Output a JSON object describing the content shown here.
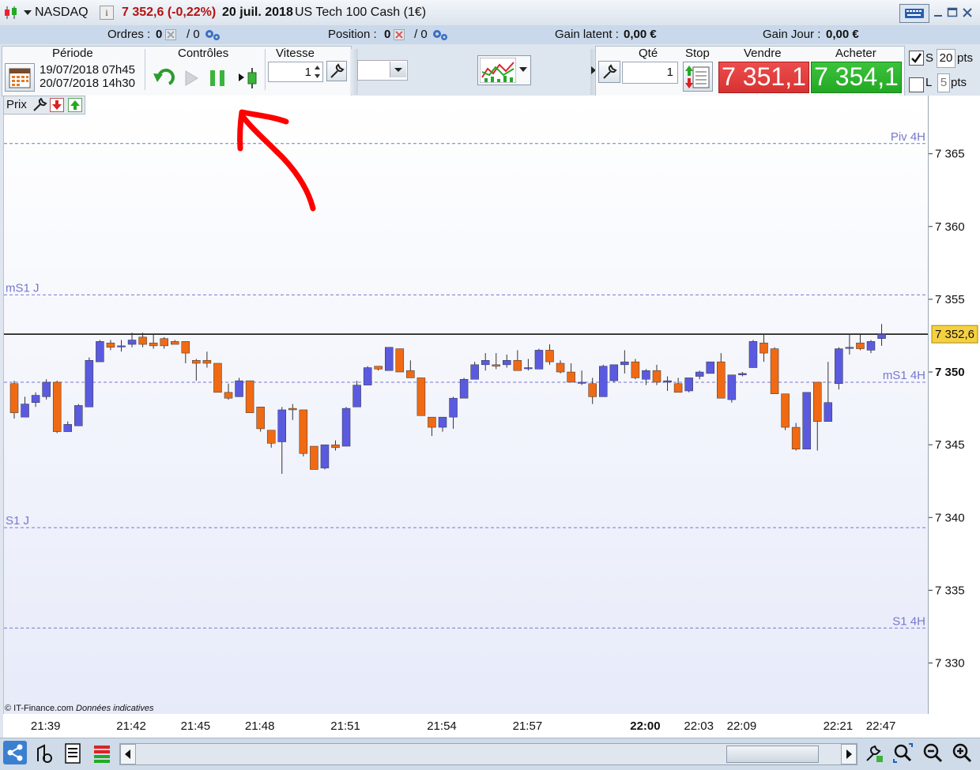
{
  "titlebar": {
    "instrument": "NASDAQ",
    "info_glyph": "i",
    "quote": "7 352,6 (-0,22%)",
    "date": "20 juil. 2018",
    "product": "US Tech 100 Cash (1€)"
  },
  "stats": {
    "orders_label": "Ordres :",
    "orders_value": "0",
    "orders_sep": "/ 0",
    "position_label": "Position :",
    "position_value": "0",
    "position_sep": "/ 0",
    "latent_label": "Gain latent :",
    "latent_value": "0,00 €",
    "day_label": "Gain Jour :",
    "day_value": "0,00 €"
  },
  "controls": {
    "period_label": "Période",
    "period_start": "19/07/2018 07h45",
    "period_end": "20/07/2018 14h30",
    "controls_label": "Contrôles",
    "speed_label": "Vitesse",
    "speed_value": "1",
    "qty_label": "Qté",
    "qty_value": "1",
    "stop_label": "Stop",
    "sell_label": "Vendre",
    "sell_price": "7 351,1",
    "buy_label": "Acheter",
    "buy_price": "7 354,1",
    "s_label": "S",
    "s_value": "20",
    "s_unit": "pts",
    "l_label": "L",
    "l_value": "5",
    "l_unit": "pts"
  },
  "chart_header": {
    "label": "Prix"
  },
  "chart_data": {
    "type": "candlestick",
    "ylim": [
      7326.5,
      7369
    ],
    "yticks": [
      7365,
      7360,
      7355,
      7350,
      7345,
      7340,
      7335,
      7330
    ],
    "ytick_labels": [
      "7 365",
      "7 360",
      "7 355",
      "7 350",
      "7 345",
      "7 340",
      "7 335",
      "7 330"
    ],
    "current_price": 7352.6,
    "current_price_label": "7 352,6",
    "levels": [
      {
        "name": "Piv 4H",
        "value": 7365.7
      },
      {
        "name": "mS1 J",
        "value": 7355.3
      },
      {
        "name": "mS1 4H",
        "value": 7349.3
      },
      {
        "name": "S1 J",
        "value": 7339.3
      },
      {
        "name": "S1 4H",
        "value": 7332.4
      }
    ],
    "xticks": [
      "21:39",
      "21:42",
      "21:45",
      "21:48",
      "21:51",
      "21:54",
      "21:57",
      "22:00",
      "22:03",
      "22:09",
      "22:21",
      "22:47"
    ],
    "colors": {
      "up": "#5a5ae0",
      "down": "#f06a14",
      "level": "#7777cc",
      "price_line": "#000000"
    },
    "candles": [
      {
        "o": 7349.2,
        "h": 7349.4,
        "l": 7346.8,
        "c": 7347.2
      },
      {
        "o": 7346.9,
        "h": 7348.3,
        "l": 7346.9,
        "c": 7347.8
      },
      {
        "o": 7347.9,
        "h": 7348.6,
        "l": 7347.6,
        "c": 7348.4
      },
      {
        "o": 7348.3,
        "h": 7349.5,
        "l": 7348.1,
        "c": 7349.3
      },
      {
        "o": 7349.3,
        "h": 7349.4,
        "l": 7345.8,
        "c": 7345.9
      },
      {
        "o": 7345.9,
        "h": 7346.6,
        "l": 7345.9,
        "c": 7346.4
      },
      {
        "o": 7346.3,
        "h": 7347.8,
        "l": 7346.3,
        "c": 7347.7
      },
      {
        "o": 7347.6,
        "h": 7351.0,
        "l": 7347.6,
        "c": 7350.8
      },
      {
        "o": 7350.7,
        "h": 7352.2,
        "l": 7350.7,
        "c": 7352.1
      },
      {
        "o": 7352.0,
        "h": 7352.2,
        "l": 7351.5,
        "c": 7351.7
      },
      {
        "o": 7351.8,
        "h": 7352.2,
        "l": 7351.4,
        "c": 7351.8
      },
      {
        "o": 7351.9,
        "h": 7352.7,
        "l": 7351.7,
        "c": 7352.2
      },
      {
        "o": 7352.4,
        "h": 7352.7,
        "l": 7351.7,
        "c": 7351.9
      },
      {
        "o": 7352.0,
        "h": 7352.6,
        "l": 7351.6,
        "c": 7351.8
      },
      {
        "o": 7352.3,
        "h": 7352.4,
        "l": 7351.6,
        "c": 7351.8
      },
      {
        "o": 7352.1,
        "h": 7352.2,
        "l": 7351.9,
        "c": 7351.9
      },
      {
        "o": 7352.1,
        "h": 7352.1,
        "l": 7350.6,
        "c": 7351.3
      },
      {
        "o": 7350.8,
        "h": 7350.9,
        "l": 7349.4,
        "c": 7350.6
      },
      {
        "o": 7350.8,
        "h": 7351.4,
        "l": 7350.3,
        "c": 7350.6
      },
      {
        "o": 7350.6,
        "h": 7350.6,
        "l": 7348.6,
        "c": 7348.6
      },
      {
        "o": 7348.6,
        "h": 7349.2,
        "l": 7348.1,
        "c": 7348.2
      },
      {
        "o": 7348.3,
        "h": 7349.6,
        "l": 7348.3,
        "c": 7349.4
      },
      {
        "o": 7349.4,
        "h": 7349.4,
        "l": 7347.2,
        "c": 7347.2
      },
      {
        "o": 7347.6,
        "h": 7347.6,
        "l": 7345.9,
        "c": 7346.1
      },
      {
        "o": 7346.0,
        "h": 7346.0,
        "l": 7344.8,
        "c": 7345.1
      },
      {
        "o": 7345.2,
        "h": 7347.6,
        "l": 7343.0,
        "c": 7347.4
      },
      {
        "o": 7347.5,
        "h": 7347.8,
        "l": 7346.7,
        "c": 7347.4
      },
      {
        "o": 7347.4,
        "h": 7347.4,
        "l": 7344.2,
        "c": 7344.4
      },
      {
        "o": 7344.9,
        "h": 7344.9,
        "l": 7343.3,
        "c": 7343.3
      },
      {
        "o": 7343.4,
        "h": 7345.0,
        "l": 7343.3,
        "c": 7345.0
      },
      {
        "o": 7345.0,
        "h": 7345.3,
        "l": 7344.6,
        "c": 7344.8
      },
      {
        "o": 7344.9,
        "h": 7347.6,
        "l": 7344.9,
        "c": 7347.5
      },
      {
        "o": 7347.6,
        "h": 7349.4,
        "l": 7347.6,
        "c": 7349.1
      },
      {
        "o": 7349.1,
        "h": 7350.4,
        "l": 7349.1,
        "c": 7350.3
      },
      {
        "o": 7350.4,
        "h": 7350.4,
        "l": 7350.1,
        "c": 7350.2
      },
      {
        "o": 7350.1,
        "h": 7351.7,
        "l": 7350.1,
        "c": 7351.7
      },
      {
        "o": 7351.6,
        "h": 7351.6,
        "l": 7350.0,
        "c": 7350.0
      },
      {
        "o": 7350.1,
        "h": 7350.8,
        "l": 7349.6,
        "c": 7349.6
      },
      {
        "o": 7349.6,
        "h": 7349.6,
        "l": 7347.0,
        "c": 7347.0
      },
      {
        "o": 7346.9,
        "h": 7346.9,
        "l": 7345.6,
        "c": 7346.2
      },
      {
        "o": 7346.2,
        "h": 7346.9,
        "l": 7345.9,
        "c": 7346.9
      },
      {
        "o": 7346.9,
        "h": 7348.3,
        "l": 7346.1,
        "c": 7348.2
      },
      {
        "o": 7348.2,
        "h": 7349.6,
        "l": 7348.2,
        "c": 7349.5
      },
      {
        "o": 7349.5,
        "h": 7350.7,
        "l": 7349.5,
        "c": 7350.5
      },
      {
        "o": 7350.5,
        "h": 7351.3,
        "l": 7350.1,
        "c": 7350.8
      },
      {
        "o": 7350.5,
        "h": 7351.3,
        "l": 7350.2,
        "c": 7350.4
      },
      {
        "o": 7350.5,
        "h": 7351.2,
        "l": 7350.3,
        "c": 7350.8
      },
      {
        "o": 7350.8,
        "h": 7351.5,
        "l": 7350.1,
        "c": 7350.1
      },
      {
        "o": 7350.3,
        "h": 7350.9,
        "l": 7350.1,
        "c": 7350.3
      },
      {
        "o": 7350.2,
        "h": 7351.6,
        "l": 7350.2,
        "c": 7351.5
      },
      {
        "o": 7351.5,
        "h": 7351.9,
        "l": 7350.5,
        "c": 7350.7
      },
      {
        "o": 7350.6,
        "h": 7350.8,
        "l": 7349.9,
        "c": 7350.0
      },
      {
        "o": 7350.0,
        "h": 7350.6,
        "l": 7349.3,
        "c": 7349.3
      },
      {
        "o": 7349.3,
        "h": 7350.1,
        "l": 7349.1,
        "c": 7349.3
      },
      {
        "o": 7349.2,
        "h": 7349.6,
        "l": 7347.8,
        "c": 7348.3
      },
      {
        "o": 7348.3,
        "h": 7350.5,
        "l": 7348.3,
        "c": 7350.4
      },
      {
        "o": 7349.4,
        "h": 7350.4,
        "l": 7349.3,
        "c": 7350.5
      },
      {
        "o": 7350.5,
        "h": 7351.5,
        "l": 7349.9,
        "c": 7350.7
      },
      {
        "o": 7350.7,
        "h": 7350.9,
        "l": 7349.5,
        "c": 7349.6
      },
      {
        "o": 7349.5,
        "h": 7350.2,
        "l": 7349.1,
        "c": 7350.1
      },
      {
        "o": 7350.1,
        "h": 7350.5,
        "l": 7349.1,
        "c": 7349.3
      },
      {
        "o": 7349.3,
        "h": 7349.7,
        "l": 7348.7,
        "c": 7349.4
      },
      {
        "o": 7349.2,
        "h": 7349.6,
        "l": 7348.9,
        "c": 7348.6
      },
      {
        "o": 7348.7,
        "h": 7349.6,
        "l": 7348.6,
        "c": 7349.6
      },
      {
        "o": 7349.7,
        "h": 7350.1,
        "l": 7349.5,
        "c": 7350.0
      },
      {
        "o": 7349.9,
        "h": 7350.7,
        "l": 7349.9,
        "c": 7350.7
      },
      {
        "o": 7350.7,
        "h": 7351.3,
        "l": 7348.2,
        "c": 7348.2
      },
      {
        "o": 7348.1,
        "h": 7349.8,
        "l": 7347.9,
        "c": 7349.8
      },
      {
        "o": 7349.8,
        "h": 7350.0,
        "l": 7349.7,
        "c": 7349.9
      },
      {
        "o": 7350.3,
        "h": 7352.2,
        "l": 7350.3,
        "c": 7352.1
      },
      {
        "o": 7352.0,
        "h": 7352.6,
        "l": 7350.7,
        "c": 7351.3
      },
      {
        "o": 7351.6,
        "h": 7351.7,
        "l": 7348.5,
        "c": 7348.5
      },
      {
        "o": 7348.5,
        "h": 7348.5,
        "l": 7346.0,
        "c": 7346.2
      },
      {
        "o": 7346.2,
        "h": 7346.5,
        "l": 7344.6,
        "c": 7344.7
      },
      {
        "o": 7344.7,
        "h": 7348.6,
        "l": 7344.7,
        "c": 7348.6
      },
      {
        "o": 7349.3,
        "h": 7349.3,
        "l": 7344.6,
        "c": 7346.6
      },
      {
        "o": 7346.6,
        "h": 7350.7,
        "l": 7346.6,
        "c": 7347.9
      },
      {
        "o": 7349.2,
        "h": 7351.7,
        "l": 7348.8,
        "c": 7351.6
      },
      {
        "o": 7351.7,
        "h": 7352.6,
        "l": 7351.2,
        "c": 7351.7
      },
      {
        "o": 7352.0,
        "h": 7352.6,
        "l": 7351.5,
        "c": 7351.6
      },
      {
        "o": 7351.5,
        "h": 7352.2,
        "l": 7351.3,
        "c": 7352.1
      },
      {
        "o": 7352.3,
        "h": 7353.3,
        "l": 7351.8,
        "c": 7352.6
      }
    ]
  },
  "copyright": {
    "main": "© IT-Finance.com",
    "note": "Données indicatives"
  },
  "annotation": {
    "color": "#ff0000"
  }
}
